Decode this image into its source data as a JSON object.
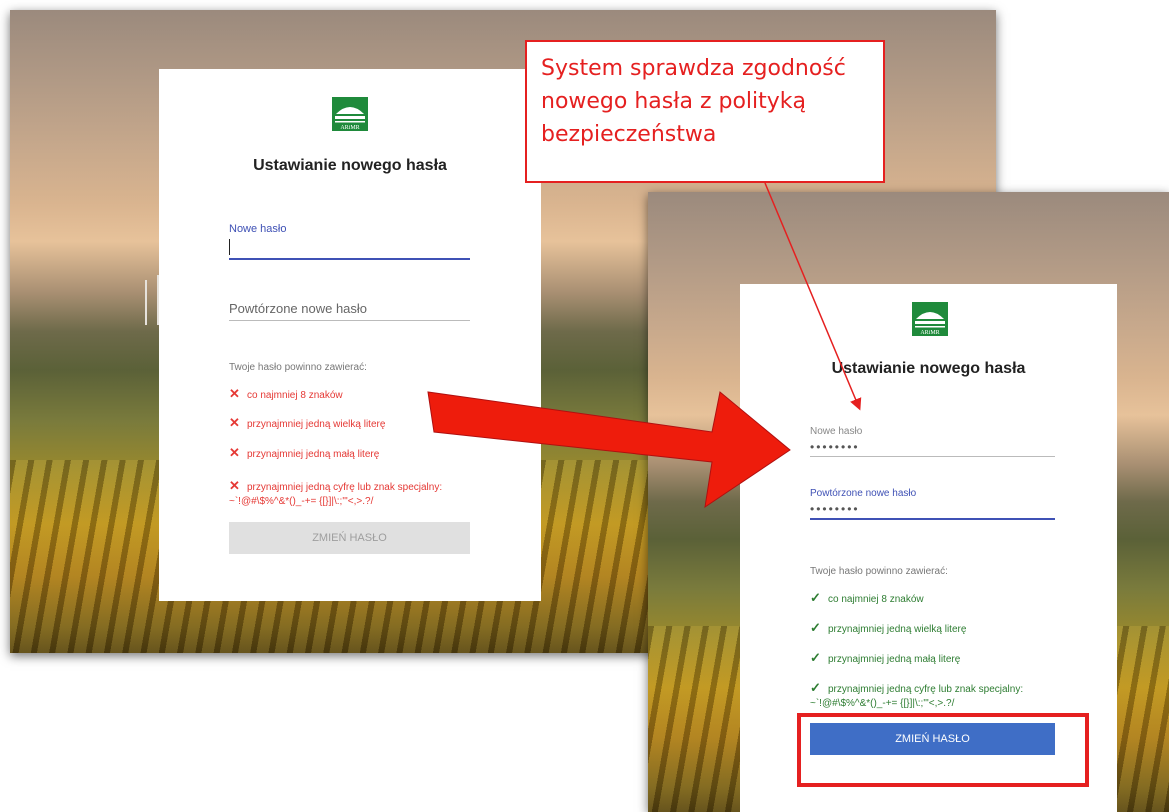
{
  "callout": {
    "lines": [
      "System sprawdza zgodność",
      "nowego hasła z polityką",
      "bezpieczeństwa"
    ]
  },
  "logo_text": "ARiMR",
  "before": {
    "title": "Ustawianie nowego hasła",
    "new_password": {
      "label": "Nowe hasło",
      "value": ""
    },
    "repeat_password": {
      "placeholder": "Powtórzone nowe hasło"
    },
    "requirements_heading": "Twoje hasło powinno zawierać:",
    "requirements": [
      {
        "text": "co najmniej 8 znaków",
        "status": "fail"
      },
      {
        "text": "przynajmniej jedną wielką literę",
        "status": "fail"
      },
      {
        "text": "przynajmniej jedną małą literę",
        "status": "fail"
      },
      {
        "text": "przynajmniej jedną cyfrę lub znak specjalny:",
        "sub": "~`!@#\\$%^&*()_-+= {[}]|\\:;\"'<,>.?/",
        "status": "fail"
      }
    ],
    "submit_label": "ZMIEŃ HASŁO",
    "submit_enabled": false
  },
  "after": {
    "title": "Ustawianie nowego hasła",
    "new_password": {
      "label": "Nowe hasło",
      "value": "••••••••"
    },
    "repeat_password": {
      "label": "Powtórzone nowe hasło",
      "value": "••••••••"
    },
    "requirements_heading": "Twoje hasło powinno zawierać:",
    "requirements": [
      {
        "text": "co najmniej 8 znaków",
        "status": "pass"
      },
      {
        "text": "przynajmniej jedną wielką literę",
        "status": "pass"
      },
      {
        "text": "przynajmniej jedną małą literę",
        "status": "pass"
      },
      {
        "text": "przynajmniej jedną cyfrę lub znak specjalny:",
        "sub": "~`!@#\\$%^&*()_-+= {[}]|\\:;\"'<,>.?/",
        "status": "pass"
      }
    ],
    "submit_label": "ZMIEŃ HASŁO",
    "submit_enabled": true
  },
  "colors": {
    "annotation_red": "#e52020",
    "fail": "#e53935",
    "pass": "#2e7d32",
    "button_enabled": "#3f6ec6",
    "field_active": "#3f51b5"
  },
  "icons": {
    "fail": "cross-icon",
    "pass": "check-icon"
  }
}
